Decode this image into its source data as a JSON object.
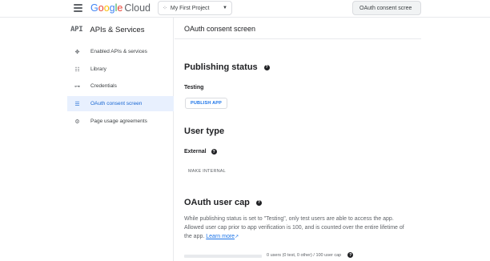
{
  "header": {
    "logo": {
      "letters": [
        "G",
        "o",
        "o",
        "g",
        "l",
        "e"
      ],
      "cloud": "Cloud"
    },
    "project_picker": {
      "label": "My First Project",
      "icon": "project-dots-icon"
    },
    "search_text": "OAuth consent scree"
  },
  "sidebar": {
    "api_mark": "API",
    "title": "APIs & Services",
    "items": [
      {
        "label": "Enabled APIs & services",
        "icon": "enabled-apis-icon",
        "glyph": "✥",
        "active": false
      },
      {
        "label": "Library",
        "icon": "library-icon",
        "glyph": "☷",
        "active": false
      },
      {
        "label": "Credentials",
        "icon": "key-icon",
        "glyph": "⊶",
        "active": false
      },
      {
        "label": "OAuth consent screen",
        "icon": "consent-screen-icon",
        "glyph": "☰",
        "active": true
      },
      {
        "label": "Page usage agreements",
        "icon": "agreements-icon",
        "glyph": "⚙",
        "active": false
      }
    ]
  },
  "main": {
    "title": "OAuth consent screen",
    "publishing": {
      "heading": "Publishing status",
      "status": "Testing",
      "publish_button": "PUBLISH APP"
    },
    "user_type": {
      "heading": "User type",
      "value": "External",
      "make_internal": "MAKE INTERNAL"
    },
    "user_cap": {
      "heading": "OAuth user cap",
      "description": "While publishing status is set to \"Testing\", only test users are able to access the app. Allowed user cap prior to app verification is 100, and is counted over the entire lifetime of the app.",
      "learn_more": "Learn more",
      "count_text": "0 users (0 test, 0 other) / 100 user cap",
      "progress_fraction": 0
    }
  },
  "colors": {
    "accent": "#1a73e8",
    "active_bg": "#e8f0fe",
    "active_text": "#1967d2"
  }
}
